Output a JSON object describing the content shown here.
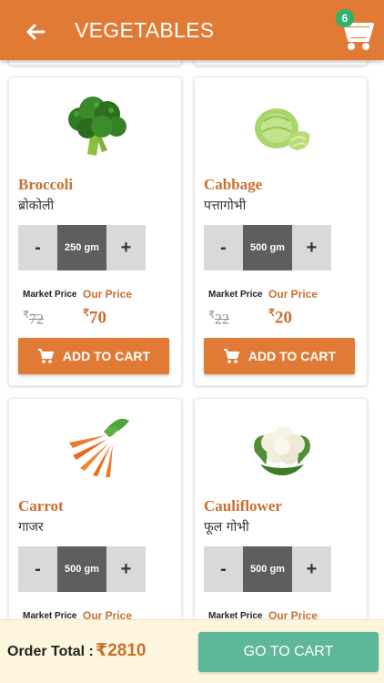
{
  "header": {
    "title": "VEGETABLES",
    "back_icon": "arrow-left-icon",
    "cart_icon": "shopping-cart-icon",
    "cart_count": "6",
    "color": "#e07a34"
  },
  "products": [
    {
      "name": "Broccoli",
      "hindi": "ब्रोकोली",
      "qty_minus": "-",
      "qty": "250 gm",
      "qty_plus": "+",
      "market_label": "Market Price",
      "our_label": "Our Price",
      "currency": "₹",
      "market_price": "72",
      "our_price": "70",
      "add_label": "ADD TO CART"
    },
    {
      "name": "Cabbage",
      "hindi": "पत्तागोभी",
      "qty_minus": "-",
      "qty": "500 gm",
      "qty_plus": "+",
      "market_label": "Market Price",
      "our_label": "Our Price",
      "currency": "₹",
      "market_price": "22",
      "our_price": "20",
      "add_label": "ADD TO CART"
    },
    {
      "name": "Carrot",
      "hindi": "गाजर",
      "qty_minus": "-",
      "qty": "500 gm",
      "qty_plus": "+",
      "market_label": "Market Price",
      "our_label": "Our Price"
    },
    {
      "name": "Cauliflower",
      "hindi": "फूल गोभी",
      "qty_minus": "-",
      "qty": "500 gm",
      "qty_plus": "+",
      "market_label": "Market Price",
      "our_label": "Our Price"
    }
  ],
  "footer": {
    "total_label": "Order Total :",
    "total_value": "₹2810",
    "go_label": "GO TO CART",
    "go_color": "#5fb79a"
  },
  "colors": {
    "accent": "#e07a34",
    "price": "#c96f30",
    "badge": "#2fb36a"
  }
}
